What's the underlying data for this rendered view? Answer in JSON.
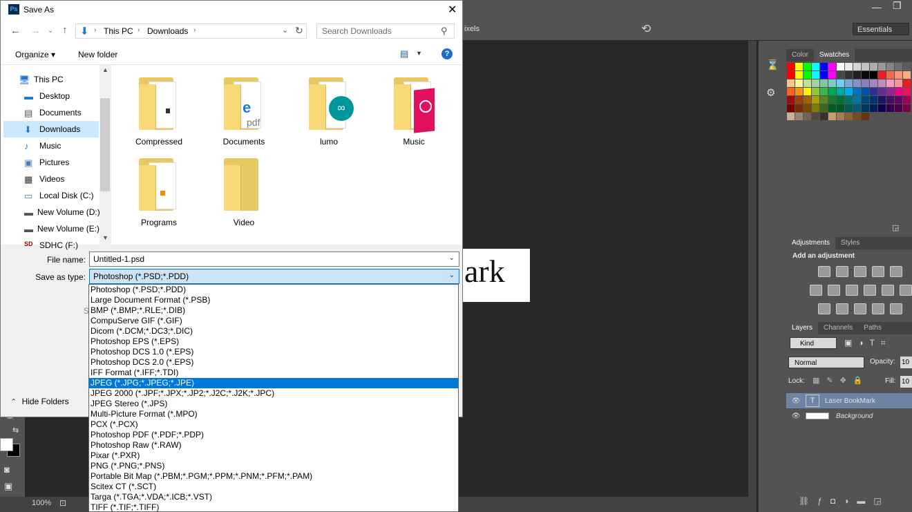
{
  "photoshop": {
    "option_bar_text": "ixels",
    "workspace": "Essentials",
    "zoom": "100%",
    "canvas_text": "ark",
    "panels": {
      "color_tab": "Color",
      "swatches_tab": "Swatches",
      "adjustments_tab": "Adjustments",
      "styles_tab": "Styles",
      "add_adjustment": "Add an adjustment",
      "layers_tab": "Layers",
      "channels_tab": "Channels",
      "paths_tab": "Paths",
      "kind_label": "Kind",
      "blend_mode": "Normal",
      "opacity_label": "Opacity:",
      "opacity_value": "10",
      "lock_label": "Lock:",
      "fill_label": "Fill:",
      "fill_value": "10",
      "layers": [
        {
          "name": "Laser BookMark",
          "type": "text"
        },
        {
          "name": "Background",
          "type": "background"
        }
      ]
    },
    "swatch_colors": [
      "#ff0000",
      "#ffff00",
      "#00ff00",
      "#00ffff",
      "#0000ff",
      "#ff00ff",
      "#ffffff",
      "#ebebeb",
      "#d6d6d6",
      "#c2c2c2",
      "#adadad",
      "#999999",
      "#858585",
      "#707070",
      "#5c5c5c",
      "#ff0000",
      "#ffff00",
      "#00ff00",
      "#00ffff",
      "#0000ff",
      "#ff00ff",
      "#474747",
      "#333333",
      "#1f1f1f",
      "#0a0a0a",
      "#000000",
      "#ee1d24",
      "#f26c4f",
      "#f69679",
      "#f9ad81",
      "#fdc689",
      "#fff799",
      "#c4df9b",
      "#a3d39c",
      "#82ca9c",
      "#7accc8",
      "#6dcff6",
      "#7da7d9",
      "#8393ca",
      "#8781bd",
      "#a187be",
      "#bd8cbf",
      "#f49ac1",
      "#f5989d",
      "#ed1c24",
      "#f26522",
      "#f7941d",
      "#fff200",
      "#8dc63f",
      "#39b54a",
      "#00a651",
      "#00a99d",
      "#00aeef",
      "#0072bc",
      "#0054a6",
      "#2e3192",
      "#662d91",
      "#92278f",
      "#ec008c",
      "#ed145b",
      "#9e0b0f",
      "#a0410d",
      "#a36209",
      "#aba000",
      "#598527",
      "#197b30",
      "#007236",
      "#00746b",
      "#0076a3",
      "#004a80",
      "#003471",
      "#1b1464",
      "#440e62",
      "#630460",
      "#9e005d",
      "#790000",
      "#7b2e00",
      "#7d4900",
      "#827b00",
      "#406618",
      "#005e20",
      "#005826",
      "#005952",
      "#005b7f",
      "#003663",
      "#002157",
      "#0d004c",
      "#32004b",
      "#4b0049",
      "#7b0046",
      "#c7b299",
      "#998675",
      "#736357",
      "#534741",
      "#37302d",
      "#c69c6d",
      "#a67c52",
      "#8c6239",
      "#754c24",
      "#603913"
    ],
    "window_controls": {
      "minimize": "—",
      "restore": "❐"
    }
  },
  "dialog": {
    "title": "Save As",
    "close": "✕",
    "breadcrumb": [
      "This PC",
      "Downloads"
    ],
    "search_placeholder": "Search Downloads",
    "organize": "Organize ▾",
    "new_folder": "New folder",
    "help": "?",
    "nav_tree": [
      {
        "label": "This PC",
        "indent": false,
        "selected": false,
        "icon": "pc-icon"
      },
      {
        "label": "Desktop",
        "indent": true,
        "selected": false,
        "icon": "desktop-icon"
      },
      {
        "label": "Documents",
        "indent": true,
        "selected": false,
        "icon": "documents-icon"
      },
      {
        "label": "Downloads",
        "indent": true,
        "selected": true,
        "icon": "downloads-icon"
      },
      {
        "label": "Music",
        "indent": true,
        "selected": false,
        "icon": "music-icon"
      },
      {
        "label": "Pictures",
        "indent": true,
        "selected": false,
        "icon": "pictures-icon"
      },
      {
        "label": "Videos",
        "indent": true,
        "selected": false,
        "icon": "videos-icon"
      },
      {
        "label": "Local Disk (C:)",
        "indent": true,
        "selected": false,
        "icon": "disk-icon"
      },
      {
        "label": "New Volume (D:)",
        "indent": true,
        "selected": false,
        "icon": "drive-icon"
      },
      {
        "label": "New Volume (E:)",
        "indent": true,
        "selected": false,
        "icon": "drive-icon"
      },
      {
        "label": "SDHC (F:)",
        "indent": true,
        "selected": false,
        "icon": "sd-icon"
      }
    ],
    "folders": [
      "Compressed",
      "Documents",
      "lumo",
      "Music",
      "Programs",
      "Video"
    ],
    "file_name_label": "File name:",
    "file_name_value": "Untitled-1.psd",
    "save_type_label": "Save as type:",
    "save_type_value": "Photoshop (*.PSD;*.PDD)",
    "hide_folders": "Hide Folders",
    "hidden_label_fragment": "S",
    "type_options": [
      "Photoshop (*.PSD;*.PDD)",
      "Large Document Format (*.PSB)",
      "BMP (*.BMP;*.RLE;*.DIB)",
      "CompuServe GIF (*.GIF)",
      "Dicom (*.DCM;*.DC3;*.DIC)",
      "Photoshop EPS (*.EPS)",
      "Photoshop DCS 1.0 (*.EPS)",
      "Photoshop DCS 2.0 (*.EPS)",
      "IFF Format (*.IFF;*.TDI)",
      "JPEG (*.JPG;*.JPEG;*.JPE)",
      "JPEG 2000 (*.JPF;*.JPX;*.JP2;*.J2C;*.J2K;*.JPC)",
      "JPEG Stereo (*.JPS)",
      "Multi-Picture Format (*.MPO)",
      "PCX (*.PCX)",
      "Photoshop PDF (*.PDF;*.PDP)",
      "Photoshop Raw (*.RAW)",
      "Pixar (*.PXR)",
      "PNG (*.PNG;*.PNS)",
      "Portable Bit Map (*.PBM;*.PGM;*.PPM;*.PNM;*.PFM;*.PAM)",
      "Scitex CT (*.SCT)",
      "Targa (*.TGA;*.VDA;*.ICB;*.VST)",
      "TIFF (*.TIF;*.TIFF)"
    ],
    "selected_type_index": 9
  }
}
